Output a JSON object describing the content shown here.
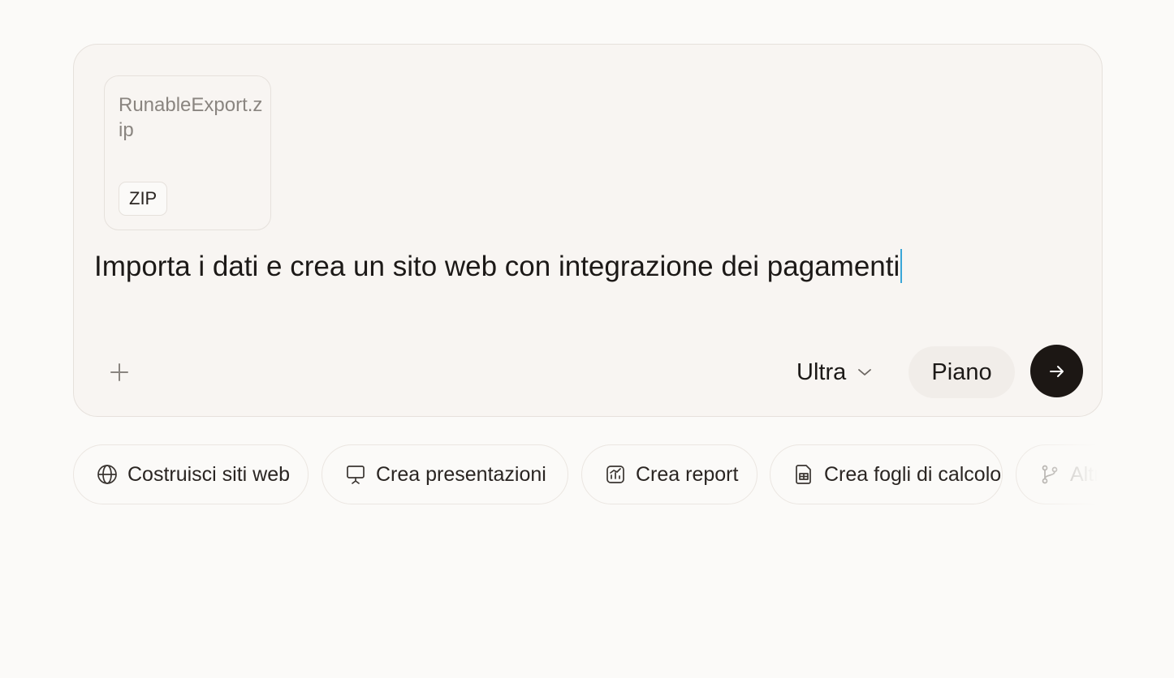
{
  "composer": {
    "attachment": {
      "file_name": "RunableExport.zip",
      "file_type": "ZIP"
    },
    "prompt_text": "Importa i dati e crea un sito web con integrazione dei pagamenti",
    "add_icon": "plus-icon",
    "model_select": {
      "selected": "Ultra",
      "icon": "chevron-down-icon"
    },
    "plan_label": "Piano",
    "send_icon": "arrow-right-icon"
  },
  "suggestions": [
    {
      "label": "Costruisci siti web",
      "icon": "globe-icon"
    },
    {
      "label": "Crea presentazioni",
      "icon": "presentation-icon"
    },
    {
      "label": "Crea report",
      "icon": "chart-icon"
    },
    {
      "label": "Crea fogli di calcolo",
      "icon": "spreadsheet-icon"
    },
    {
      "label": "Altro",
      "icon": "branch-icon"
    }
  ],
  "colors": {
    "background": "#fbfaf8",
    "composer_bg": "#f8f5f2",
    "send_button": "#1c1714",
    "caret": "#3aa6d8"
  }
}
